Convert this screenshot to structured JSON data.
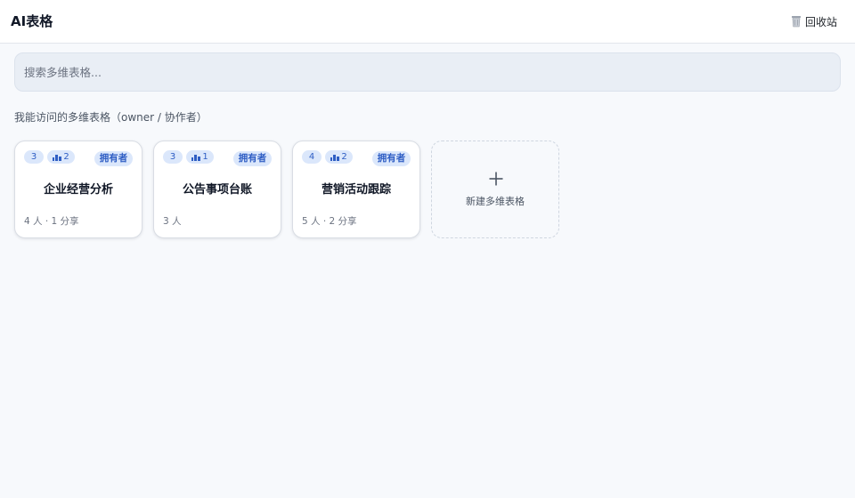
{
  "header": {
    "app_title": "AI表格",
    "trash_label": "回收站",
    "trash_icon": "trash-icon"
  },
  "search": {
    "placeholder": "搜索多维表格...",
    "value": ""
  },
  "section": {
    "title": "我能访问的多维表格（owner / 协作者）"
  },
  "cards": [
    {
      "count": "3",
      "shares": "2",
      "role": "拥有者",
      "title": "企业经营分析",
      "meta": "4 人 · 1 分享"
    },
    {
      "count": "3",
      "shares": "1",
      "role": "拥有者",
      "title": "公告事项台账",
      "meta": "3 人"
    },
    {
      "count": "4",
      "shares": "2",
      "role": "拥有者",
      "title": "营销活动跟踪",
      "meta": "5 人 · 2 分享"
    }
  ],
  "new_card": {
    "label": "新建多维表格",
    "icon": "plus-icon"
  },
  "colors": {
    "accent": "#2f5ec4",
    "chip_bg": "#dbe7fb",
    "page_bg": "#f7f9fc"
  }
}
